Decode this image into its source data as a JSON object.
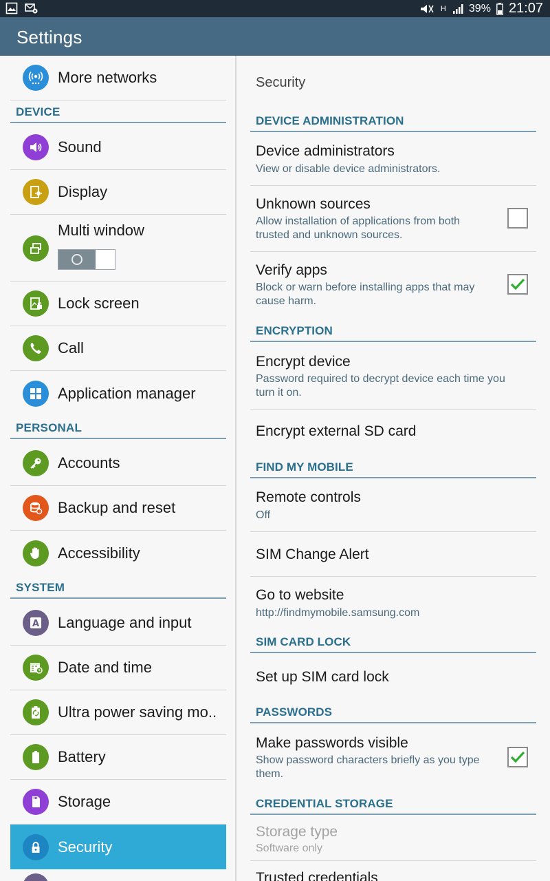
{
  "status_bar": {
    "battery": "39%",
    "time": "21:07",
    "network_type": "H"
  },
  "app_bar": {
    "title": "Settings"
  },
  "left": {
    "top_item": {
      "label": "More networks",
      "icon": "more-networks-icon",
      "color": "#2a8fd8"
    },
    "sections": [
      {
        "header": "DEVICE"
      },
      {
        "header": "PERSONAL"
      },
      {
        "header": "SYSTEM"
      }
    ],
    "device_items": [
      {
        "label": "Sound",
        "icon": "sound-icon",
        "color": "#8f3ed6"
      },
      {
        "label": "Display",
        "icon": "display-icon",
        "color": "#c8a012"
      },
      {
        "label": "Multi window",
        "icon": "multi-window-icon",
        "color": "#5c9a22",
        "toggle": "off"
      },
      {
        "label": "Lock screen",
        "icon": "lock-screen-icon",
        "color": "#5c9a22"
      },
      {
        "label": "Call",
        "icon": "call-icon",
        "color": "#5c9a22"
      },
      {
        "label": "Application manager",
        "icon": "apps-icon",
        "color": "#2a8fd8"
      }
    ],
    "personal_items": [
      {
        "label": "Accounts",
        "icon": "key-icon",
        "color": "#5c9a22"
      },
      {
        "label": "Backup and reset",
        "icon": "backup-icon",
        "color": "#e2581c"
      },
      {
        "label": "Accessibility",
        "icon": "hand-icon",
        "color": "#5c9a22"
      }
    ],
    "system_items": [
      {
        "label": "Language and input",
        "icon": "language-icon",
        "color": "#6b5f8a"
      },
      {
        "label": "Date and time",
        "icon": "calendar-icon",
        "color": "#5c9a22"
      },
      {
        "label": "Ultra power saving mo..",
        "icon": "power-saving-icon",
        "color": "#5c9a22"
      },
      {
        "label": "Battery",
        "icon": "battery-icon",
        "color": "#5c9a22"
      },
      {
        "label": "Storage",
        "icon": "storage-icon",
        "color": "#8f3ed6"
      },
      {
        "label": "Security",
        "icon": "lock-icon",
        "color": "#1d86c2",
        "selected": true
      }
    ]
  },
  "right": {
    "title": "Security",
    "headers": {
      "device_admin": "DEVICE ADMINISTRATION",
      "encryption": "ENCRYPTION",
      "find_my_mobile": "FIND MY MOBILE",
      "sim_card_lock": "SIM CARD LOCK",
      "passwords": "PASSWORDS",
      "credential_storage": "CREDENTIAL STORAGE"
    },
    "items": {
      "device_admins": {
        "title": "Device administrators",
        "summary": "View or disable device administrators."
      },
      "unknown_sources": {
        "title": "Unknown sources",
        "summary": "Allow installation of applications from both trusted and unknown sources.",
        "checked": false
      },
      "verify_apps": {
        "title": "Verify apps",
        "summary": "Block or warn before installing apps that may cause harm.",
        "checked": true
      },
      "encrypt_device": {
        "title": "Encrypt device",
        "summary": "Password required to decrypt device each time you turn it on."
      },
      "encrypt_sd": {
        "title": "Encrypt external SD card"
      },
      "remote_controls": {
        "title": "Remote controls",
        "summary": "Off"
      },
      "sim_change_alert": {
        "title": "SIM Change Alert"
      },
      "go_to_website": {
        "title": "Go to website",
        "summary": "http://findmymobile.samsung.com"
      },
      "sim_lock": {
        "title": "Set up SIM card lock"
      },
      "passwords_visible": {
        "title": "Make passwords visible",
        "summary": "Show password characters briefly as you type them.",
        "checked": true
      },
      "storage_type": {
        "title": "Storage type",
        "summary": "Software only"
      },
      "trusted_credentials": {
        "title": "Trusted credentials"
      }
    }
  }
}
